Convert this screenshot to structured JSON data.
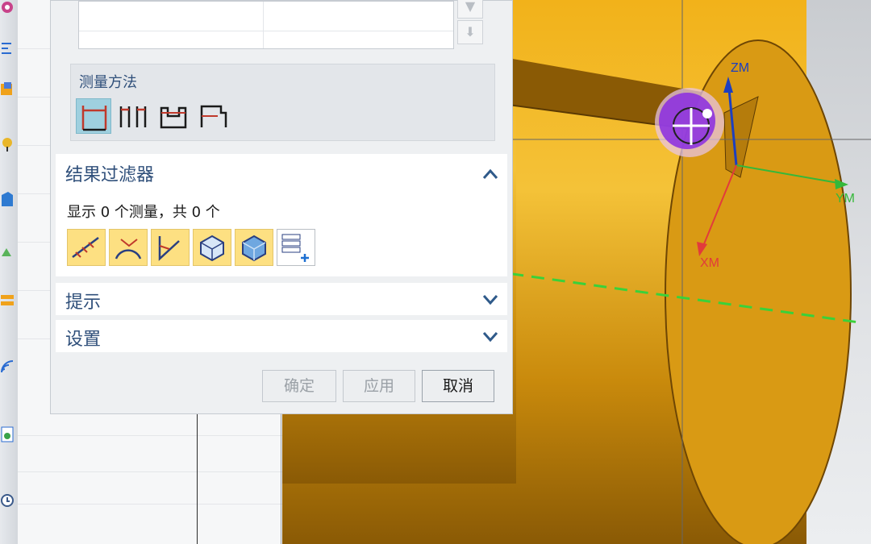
{
  "dialog": {
    "method_group": {
      "title": "测量方法",
      "icons": [
        "distance-method-icon",
        "multi-distance-method-icon",
        "chain-distance-method-icon",
        "pair-distance-method-icon"
      ]
    },
    "result_filter": {
      "title": "结果过滤器",
      "summary": "显示 0 个测量，共 0 个",
      "tools": [
        "distance-filter-icon",
        "angle-filter-icon",
        "radius-filter-icon",
        "volume-filter-icon",
        "mass-filter-icon",
        "add-filter-icon"
      ]
    },
    "hints": {
      "title": "提示"
    },
    "settings": {
      "title": "设置"
    },
    "buttons": {
      "ok": "确定",
      "apply": "应用",
      "cancel": "取消"
    }
  },
  "viewport": {
    "axes": {
      "z": "ZM",
      "y": "YM",
      "x": "XM"
    },
    "colors": {
      "part": "#e9a512",
      "face": "#d99a14",
      "x_axis": "#e23b3b",
      "y_axis": "#35b83a",
      "z_axis": "#1d3fbf",
      "cursor": "#8a2be2"
    }
  }
}
